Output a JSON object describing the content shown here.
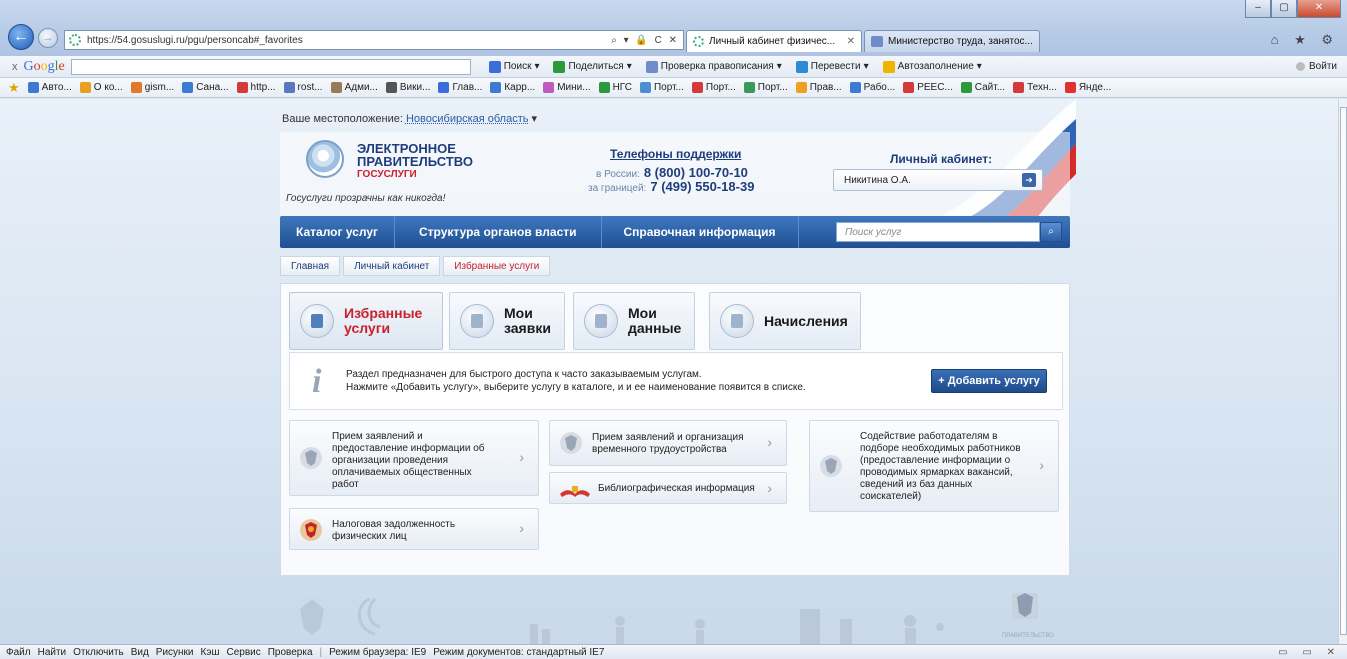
{
  "browser": {
    "window_controls": [
      "–",
      "▢",
      "✕"
    ],
    "address": "https://54.gosuslugi.ru/pgu/personcab#_favorites",
    "address_actions": "⌕ ▾ 🔒 C ✕",
    "tabs": [
      {
        "label": "Личный кабинет физичес...",
        "close": "✕"
      },
      {
        "label": "Министерство труда, занятос..."
      }
    ],
    "right_icons": "⌂ ★ ⚙"
  },
  "google_toolbar": {
    "close": "x",
    "logo": [
      "G",
      "o",
      "o",
      "g",
      "l",
      "e"
    ],
    "tools": [
      "Поиск",
      "Поделиться",
      "Проверка правописания",
      "Перевести",
      "Автозаполнение"
    ],
    "tool_colors": [
      "#3b6dd8",
      "#2c9a3c",
      "#6f8cc8",
      "#2c8ad6",
      "#f0b400"
    ],
    "signin": "Войти"
  },
  "favorites": [
    {
      "label": "Авто...",
      "color": "#3b7bd4"
    },
    {
      "label": "О ко...",
      "color": "#e8a020"
    },
    {
      "label": "gism...",
      "color": "#e07a2a"
    },
    {
      "label": "Сана...",
      "color": "#3b7bd4"
    },
    {
      "label": "http...",
      "color": "#d43a3a"
    },
    {
      "label": "rost...",
      "color": "#5a78c0"
    },
    {
      "label": "Адми...",
      "color": "#9a7a5a"
    },
    {
      "label": "Вики...",
      "color": "#555555"
    },
    {
      "label": "Глав...",
      "color": "#3b6dd8"
    },
    {
      "label": "Карр...",
      "color": "#3b7bd4"
    },
    {
      "label": "Мини...",
      "color": "#c05ac0"
    },
    {
      "label": "НГС",
      "color": "#2c9a3c"
    },
    {
      "label": "Порт...",
      "color": "#4a90d0"
    },
    {
      "label": "Порт...",
      "color": "#d43a3a"
    },
    {
      "label": "Порт...",
      "color": "#3a9a5a"
    },
    {
      "label": "Прав...",
      "color": "#f0a020"
    },
    {
      "label": "Рабо...",
      "color": "#3b7bd4"
    },
    {
      "label": "РЕЕС...",
      "color": "#d43a3a"
    },
    {
      "label": "Сайт...",
      "color": "#2c9a3c"
    },
    {
      "label": "Техн...",
      "color": "#d43a3a"
    },
    {
      "label": "Янде...",
      "color": "#e03030"
    }
  ],
  "page": {
    "location_label": "Ваше местоположение:",
    "location_value": "Новосибирская область",
    "logo": {
      "line1": "ЭЛЕКТРОННОЕ",
      "line2": "ПРАВИТЕЛЬСТВО",
      "line3": "ГОСУСЛУГИ",
      "slogan": "Госуслуги прозрачны как никогда!"
    },
    "phones": {
      "title": "Телефоны поддержки",
      "russia_label": "в России:",
      "russia": "8 (800) 100-70-10",
      "abroad_label": "за границей:",
      "abroad": "7 (499) 550-18-39"
    },
    "cabinet": {
      "title": "Личный кабинет:",
      "user": "Никитина О.А."
    },
    "nav": [
      "Каталог услуг",
      "Структура органов власти",
      "Справочная информация"
    ],
    "search_placeholder": "Поиск услуг",
    "breadcrumbs": [
      "Главная",
      "Личный кабинет",
      "Избранные услуги"
    ],
    "subtabs": [
      {
        "line1": "Избранные",
        "line2": "услуги"
      },
      {
        "line1": "Мои",
        "line2": "заявки"
      },
      {
        "line1": "Мои",
        "line2": "данные"
      },
      {
        "line1": "Начисления",
        "line2": ""
      }
    ],
    "info_line1": "Раздел предназначен для быстрого доступа к часто заказываемым услугам.",
    "info_line2": "Нажмите «Добавить услугу», выберите услугу в каталоге, и и ее наименование появится в списке.",
    "add_button": "+ Добавить услугу",
    "services": [
      "Прием заявлений и предоставление информации об организации проведения оплачиваемых общественных работ",
      "Прием заявлений и организация временного трудоустройства",
      "Содействие работодателям в подборе необходимых работников (предоставление информации о проводимых ярмарках вакансий, сведений из баз данных соискателей)",
      "Библиографическая информация",
      "Налоговая задолженность физических лиц"
    ],
    "footer_caption": "ПРАВИТЕЛЬСТВО"
  },
  "statusbar": {
    "items": [
      "Файл",
      "Найти",
      "Отключить",
      "Вид",
      "Рисунки",
      "Кэш",
      "Сервис",
      "Проверка"
    ],
    "mode1": "Режим браузера: IE9",
    "mode2": "Режим документов: стандартный IE7",
    "right": "▭ ▭ ✕"
  }
}
